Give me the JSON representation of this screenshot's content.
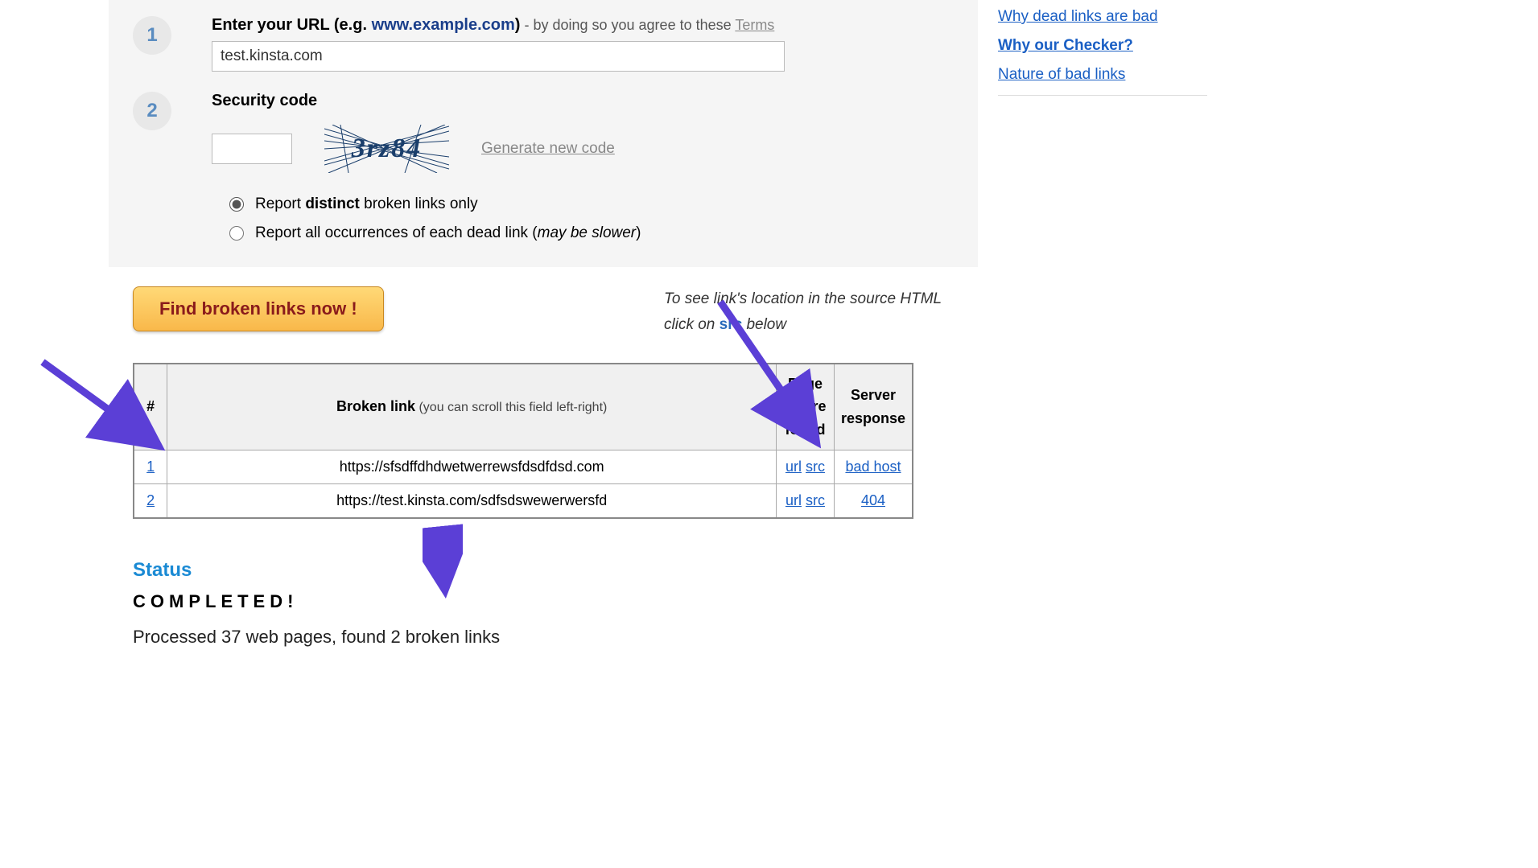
{
  "steps": {
    "step1": {
      "num": "1",
      "label_bold": "Enter your URL",
      "label_example_prefix": " (e.g. ",
      "label_example_url": "www.example.com",
      "label_example_suffix": ")",
      "agree_text": " - by doing so you agree to these ",
      "terms_link": "Terms",
      "input_value": "test.kinsta.com"
    },
    "step2": {
      "num": "2",
      "label": "Security code",
      "captcha_text": "3rz84",
      "generate_link": "Generate new code",
      "radio1_prefix": "Report ",
      "radio1_bold": "distinct",
      "radio1_suffix": " broken links only",
      "radio2_prefix": "Report all occurrences of each dead link (",
      "radio2_italic": "may be slower",
      "radio2_suffix": ")"
    }
  },
  "results": {
    "button_label": "Find broken links now !",
    "hint_line1": "To see link's location in the source HTML",
    "hint_line2a": "click on ",
    "hint_line2_src": "src",
    "hint_line2b": " below",
    "table": {
      "col_num": "#",
      "col_link": "Broken link",
      "col_link_hint": " (you can scroll this field left-right)",
      "col_found": "Page where found",
      "col_resp": "Server response",
      "rows": [
        {
          "n": "1",
          "url": "https://sfsdffdhdwetwerrewsfdsdfdsd.com",
          "url_label": "url",
          "src_label": "src",
          "resp": "bad host"
        },
        {
          "n": "2",
          "url": "https://test.kinsta.com/sdfsdswewerwersfd",
          "url_label": "url",
          "src_label": "src",
          "resp": "404"
        }
      ]
    },
    "status": {
      "title": "Status",
      "completed": "COMPLETED!",
      "summary": "Processed 37 web pages, found 2 broken links"
    }
  },
  "sidebar": {
    "link1": "Why dead links are bad",
    "link2": "Why our Checker?",
    "link3": "Nature of bad links"
  }
}
